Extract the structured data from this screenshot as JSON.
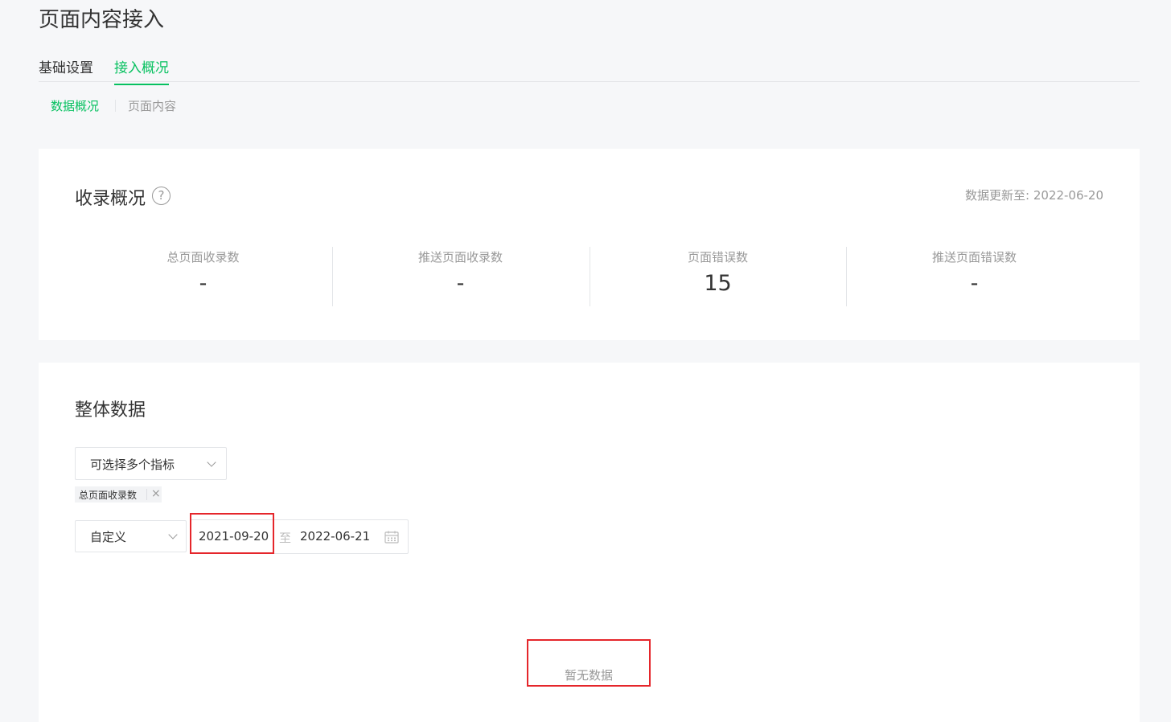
{
  "page": {
    "title": "页面内容接入"
  },
  "tabs": [
    {
      "label": "基础设置",
      "active": false
    },
    {
      "label": "接入概况",
      "active": true
    }
  ],
  "subtabs": [
    {
      "label": "数据概况",
      "active": true
    },
    {
      "label": "页面内容",
      "active": false
    }
  ],
  "overview": {
    "title": "收录概况",
    "help_icon": "question-circle-icon",
    "update_time": "数据更新至: 2022-06-20",
    "stats": [
      {
        "label": "总页面收录数",
        "value": "-"
      },
      {
        "label": "推送页面收录数",
        "value": "-"
      },
      {
        "label": "页面错误数",
        "value": "15"
      },
      {
        "label": "推送页面错误数",
        "value": "-"
      }
    ]
  },
  "overall": {
    "title": "整体数据",
    "metric_select": {
      "placeholder": "可选择多个指标"
    },
    "selected_tags": [
      {
        "label": "总页面收录数",
        "close": "×"
      }
    ],
    "range_select": {
      "value": "自定义"
    },
    "date_range": {
      "start": "2021-09-20",
      "separator": "至",
      "end": "2022-06-21"
    },
    "empty_text": "暂无数据"
  },
  "colors": {
    "accent": "#07c160",
    "highlight": "#e5262b",
    "background": "#f6f7f9"
  }
}
